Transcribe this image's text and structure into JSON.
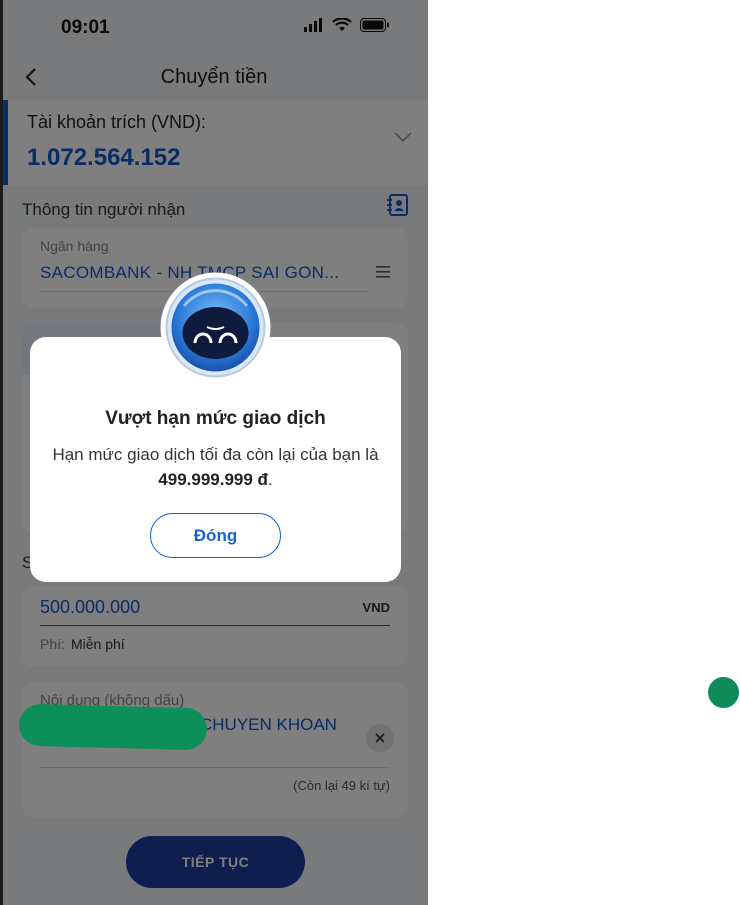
{
  "status_bar": {
    "time": "09:01"
  },
  "nav": {
    "title": "Chuyển tiền"
  },
  "account": {
    "label": "Tài khoản trích (VND):",
    "balance": "1.072.564.152"
  },
  "recipient": {
    "section_title": "Thông tin người nhận",
    "bank_label": "Ngân hàng",
    "bank_value": "SACOMBANK - NH TMCP SAI GON..."
  },
  "amount": {
    "value": "500.000.000",
    "currency": "VND",
    "fee_label": "Phí:",
    "fee_value": "Miễn phí"
  },
  "description": {
    "label": "Nội dung (không dấu)",
    "value": "CHUYEN KHOAN",
    "char_count": "(Còn lại 49 kí tự)"
  },
  "continue_label": "TIẾP TỤC",
  "dialog": {
    "title": "Vượt hạn mức giao dịch",
    "message_prefix": "Hạn mức giao dịch tối đa còn lại của bạn là ",
    "limit": "499.999.999 đ",
    "message_suffix": ".",
    "close_label": "Đóng"
  },
  "colors": {
    "primary": "#1656c8",
    "button": "#1c3c9e",
    "error_line": "#d9262b",
    "redaction": "#0d8f5c"
  }
}
